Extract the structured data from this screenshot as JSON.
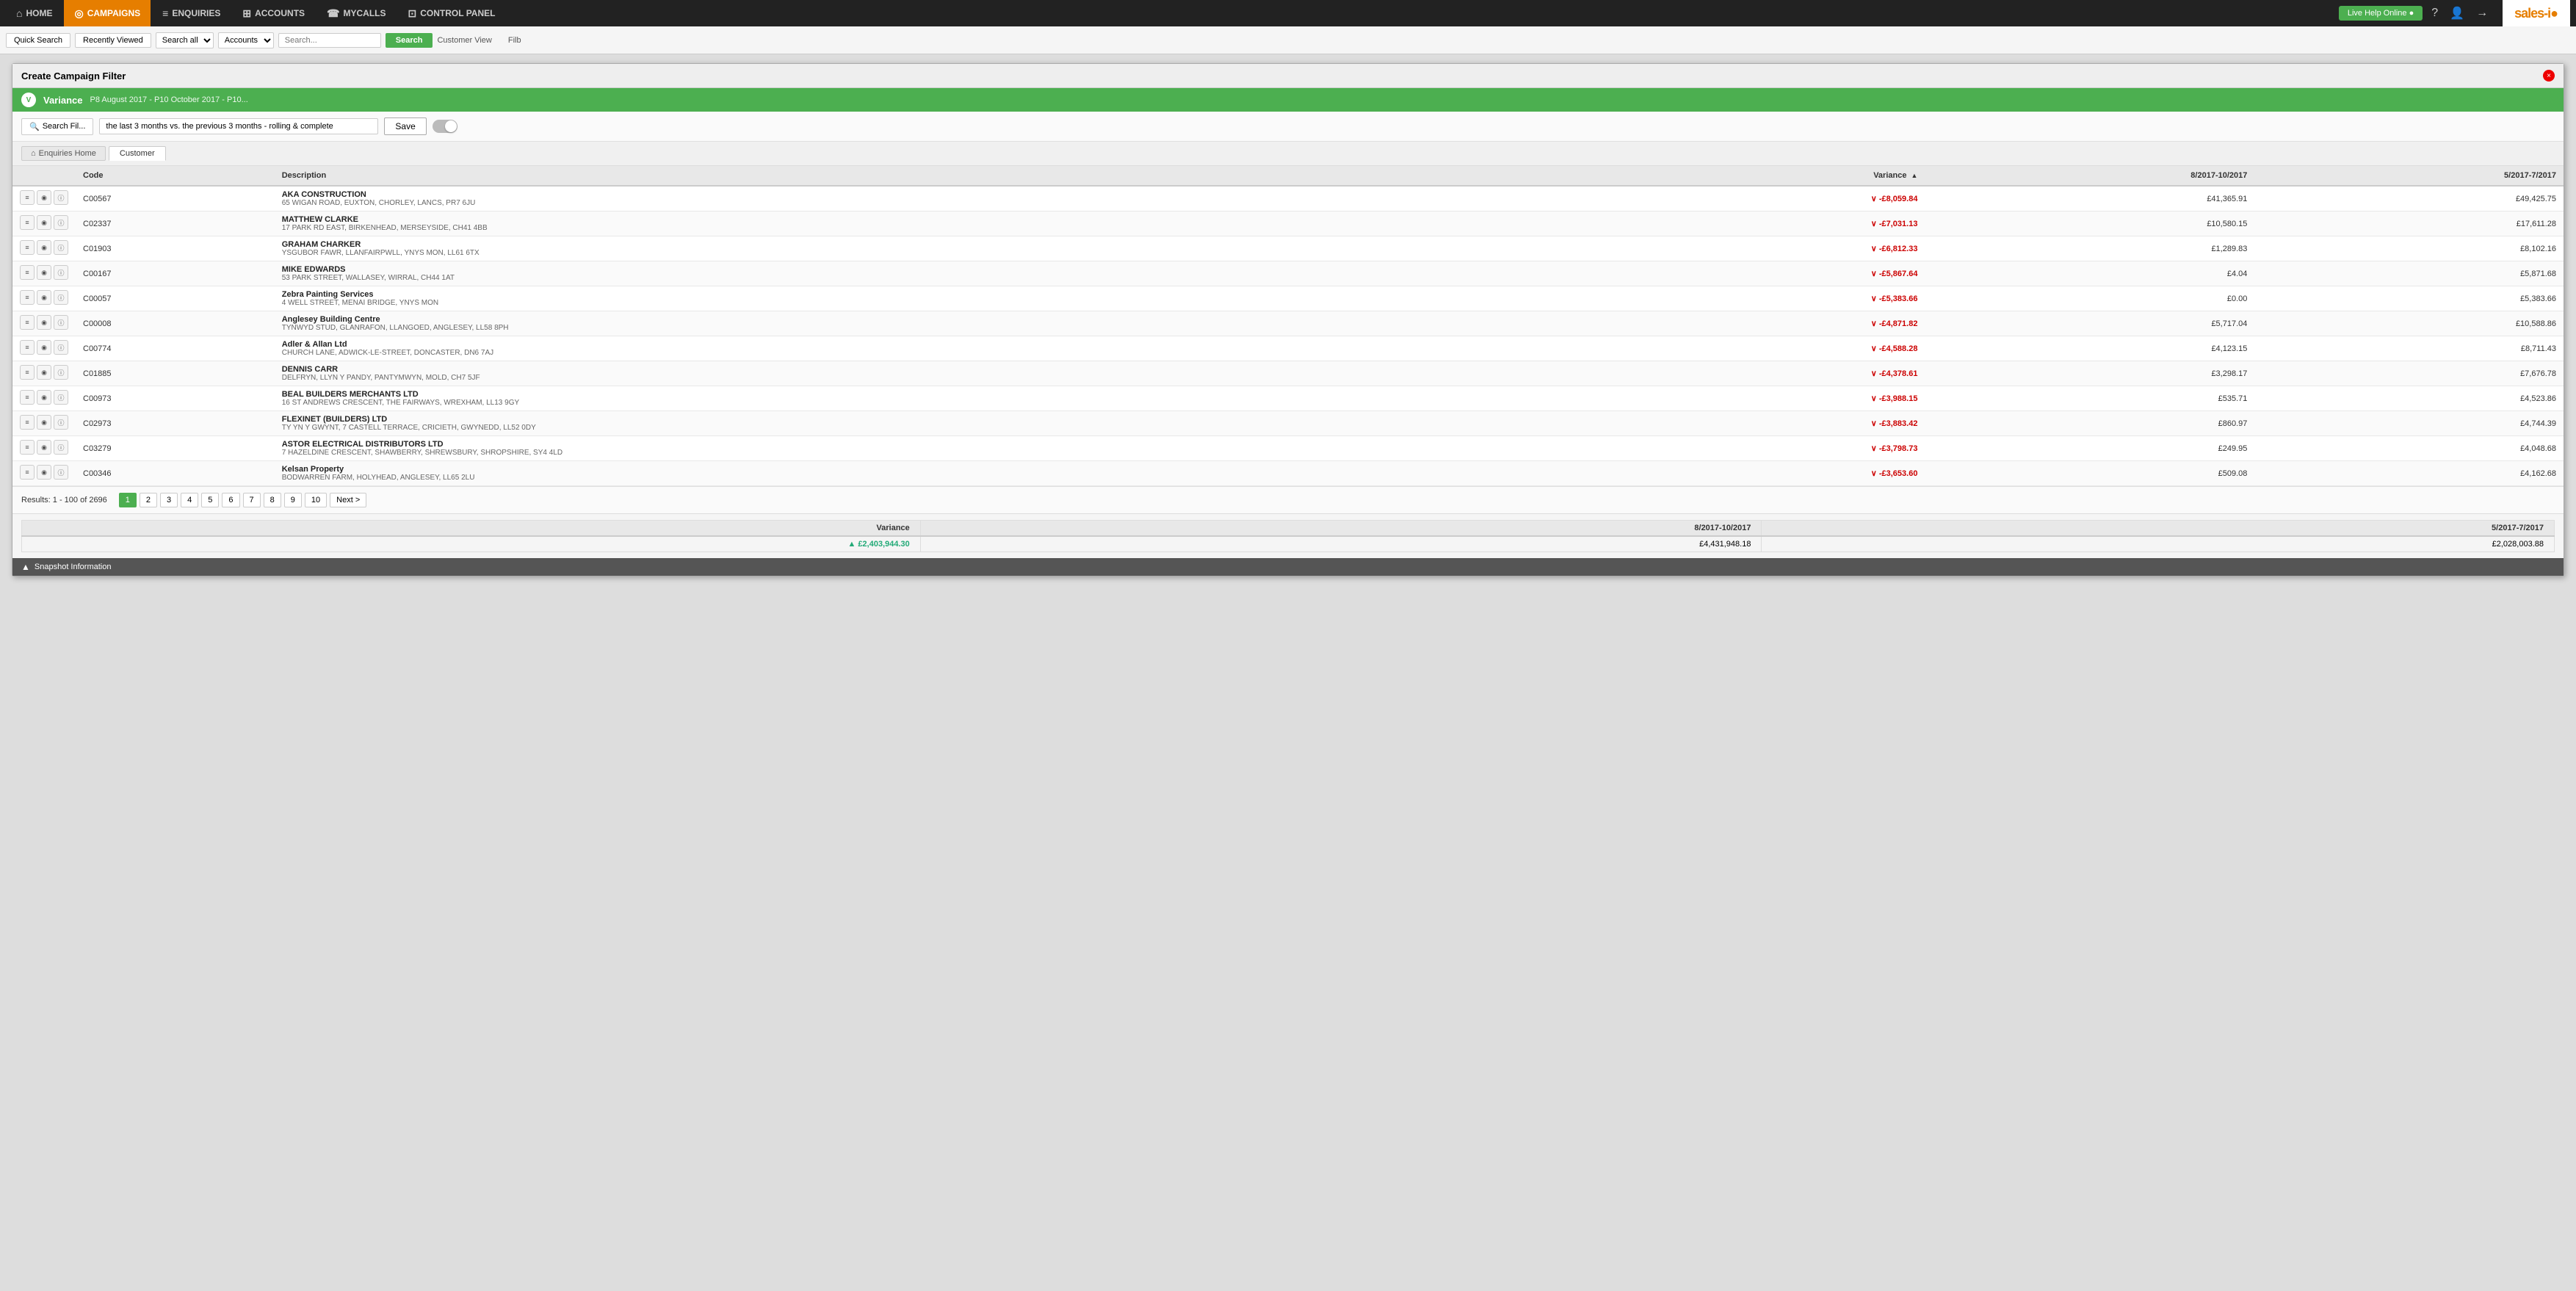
{
  "nav": {
    "items": [
      {
        "label": "HOME",
        "icon": "⌂",
        "active": false
      },
      {
        "label": "CAMPAIGNS",
        "icon": "◎",
        "active": true
      },
      {
        "label": "ENQUIRIES",
        "icon": "≡",
        "active": false
      },
      {
        "label": "ACCOUNTS",
        "icon": "⊞",
        "active": false
      },
      {
        "label": "MYCALLS",
        "icon": "☎",
        "active": false
      },
      {
        "label": "CONTROL PANEL",
        "icon": "⊡",
        "active": false
      }
    ],
    "live_help": "Live Help Online ●",
    "logo": "sales-i"
  },
  "toolbar": {
    "quick_search": "Quick Search",
    "recently_viewed": "Recently Viewed",
    "search_all": "Search all",
    "accounts": "Accounts",
    "search_placeholder": "Search...",
    "search_btn": "Search",
    "customer_view": "Customer View",
    "filb": "Filb"
  },
  "modal": {
    "title": "Create Campaign Filter",
    "close_btn": "×"
  },
  "variance_bar": {
    "label": "Variance",
    "period": "P8 August 2017 - P10 October 2017 - P10..."
  },
  "filter_row": {
    "search_filter_btn": "Search Fil...",
    "filter_text": "the last 3 months vs. the previous 3 months - rolling & complete",
    "save_btn": "Save"
  },
  "breadcrumb": {
    "home_label": "Enquiries Home",
    "tab_label": "Customer"
  },
  "table": {
    "columns": [
      "",
      "Code",
      "Description",
      "Variance",
      "8/2017-10/2017",
      "5/2017-7/2017"
    ],
    "rows": [
      {
        "code": "C00567",
        "company": "AKA CONSTRUCTION",
        "address": "65 WIGAN ROAD, EUXTON, CHORLEY, LANCS, PR7 6JU",
        "variance": "-£8,059.84",
        "col1": "£41,365.91",
        "col2": "£49,425.75"
      },
      {
        "code": "C02337",
        "company": "MATTHEW CLARKE",
        "address": "17 PARK RD EAST, BIRKENHEAD, MERSEYSIDE, CH41 4BB",
        "variance": "-£7,031.13",
        "col1": "£10,580.15",
        "col2": "£17,611.28"
      },
      {
        "code": "C01903",
        "company": "GRAHAM CHARKER",
        "address": "YSGUBOR FAWR, LLANFAIRPWLL, YNYS MON, LL61 6TX",
        "variance": "-£6,812.33",
        "col1": "£1,289.83",
        "col2": "£8,102.16"
      },
      {
        "code": "C00167",
        "company": "MIKE EDWARDS",
        "address": "53 PARK STREET, WALLASEY, WIRRAL, CH44 1AT",
        "variance": "-£5,867.64",
        "col1": "£4.04",
        "col2": "£5,871.68"
      },
      {
        "code": "C00057",
        "company": "Zebra Painting Services",
        "address": "4 WELL STREET, MENAI BRIDGE, YNYS MON",
        "variance": "-£5,383.66",
        "col1": "£0.00",
        "col2": "£5,383.66"
      },
      {
        "code": "C00008",
        "company": "Anglesey Building Centre",
        "address": "TYNWYD STUD, GLANRAFON, LLANGOED, ANGLESEY, LL58 8PH",
        "variance": "-£4,871.82",
        "col1": "£5,717.04",
        "col2": "£10,588.86"
      },
      {
        "code": "C00774",
        "company": "Adler & Allan Ltd",
        "address": "CHURCH LANE, ADWICK-LE-STREET, DONCASTER, DN6 7AJ",
        "variance": "-£4,588.28",
        "col1": "£4,123.15",
        "col2": "£8,711.43"
      },
      {
        "code": "C01885",
        "company": "DENNIS CARR",
        "address": "DELFRYN, LLYN Y PANDY, PANTYMWYN, MOLD, CH7 5JF",
        "variance": "-£4,378.61",
        "col1": "£3,298.17",
        "col2": "£7,676.78"
      },
      {
        "code": "C00973",
        "company": "BEAL BUILDERS MERCHANTS LTD",
        "address": "16 ST ANDREWS CRESCENT, THE FAIRWAYS, WREXHAM, LL13 9GY",
        "variance": "-£3,988.15",
        "col1": "£535.71",
        "col2": "£4,523.86"
      },
      {
        "code": "C02973",
        "company": "FLEXINET (BUILDERS) LTD",
        "address": "TY YN Y GWYNT, 7 CASTELL TERRACE, CRICIETH, GWYNEDD, LL52 0DY",
        "variance": "-£3,883.42",
        "col1": "£860.97",
        "col2": "£4,744.39"
      },
      {
        "code": "C03279",
        "company": "ASTOR ELECTRICAL DISTRIBUTORS LTD",
        "address": "7 HAZELDINE CRESCENT, SHAWBERRY, SHREWSBURY, SHROPSHIRE, SY4 4LD",
        "variance": "-£3,798.73",
        "col1": "£249.95",
        "col2": "£4,048.68"
      },
      {
        "code": "C00346",
        "company": "Kelsan Property",
        "address": "BODWARREN FARM, HOLYHEAD, ANGLESEY, LL65 2LU",
        "variance": "-£3,653.60",
        "col1": "£509.08",
        "col2": "£4,162.68"
      }
    ]
  },
  "footer": {
    "results_text": "Results: 1 - 100 of 2696",
    "pages": [
      "1",
      "2",
      "3",
      "4",
      "5",
      "6",
      "7",
      "8",
      "9",
      "10"
    ],
    "next_btn": "Next >"
  },
  "summary": {
    "variance_label": "Variance",
    "col1_label": "8/2017-10/2017",
    "col2_label": "5/2017-7/2017",
    "variance_total": "£2,403,944.30",
    "col1_total": "£4,431,948.18",
    "col2_total": "£2,028,003.88"
  },
  "snapshot": {
    "icon": "▲",
    "label": "Snapshot Information"
  }
}
